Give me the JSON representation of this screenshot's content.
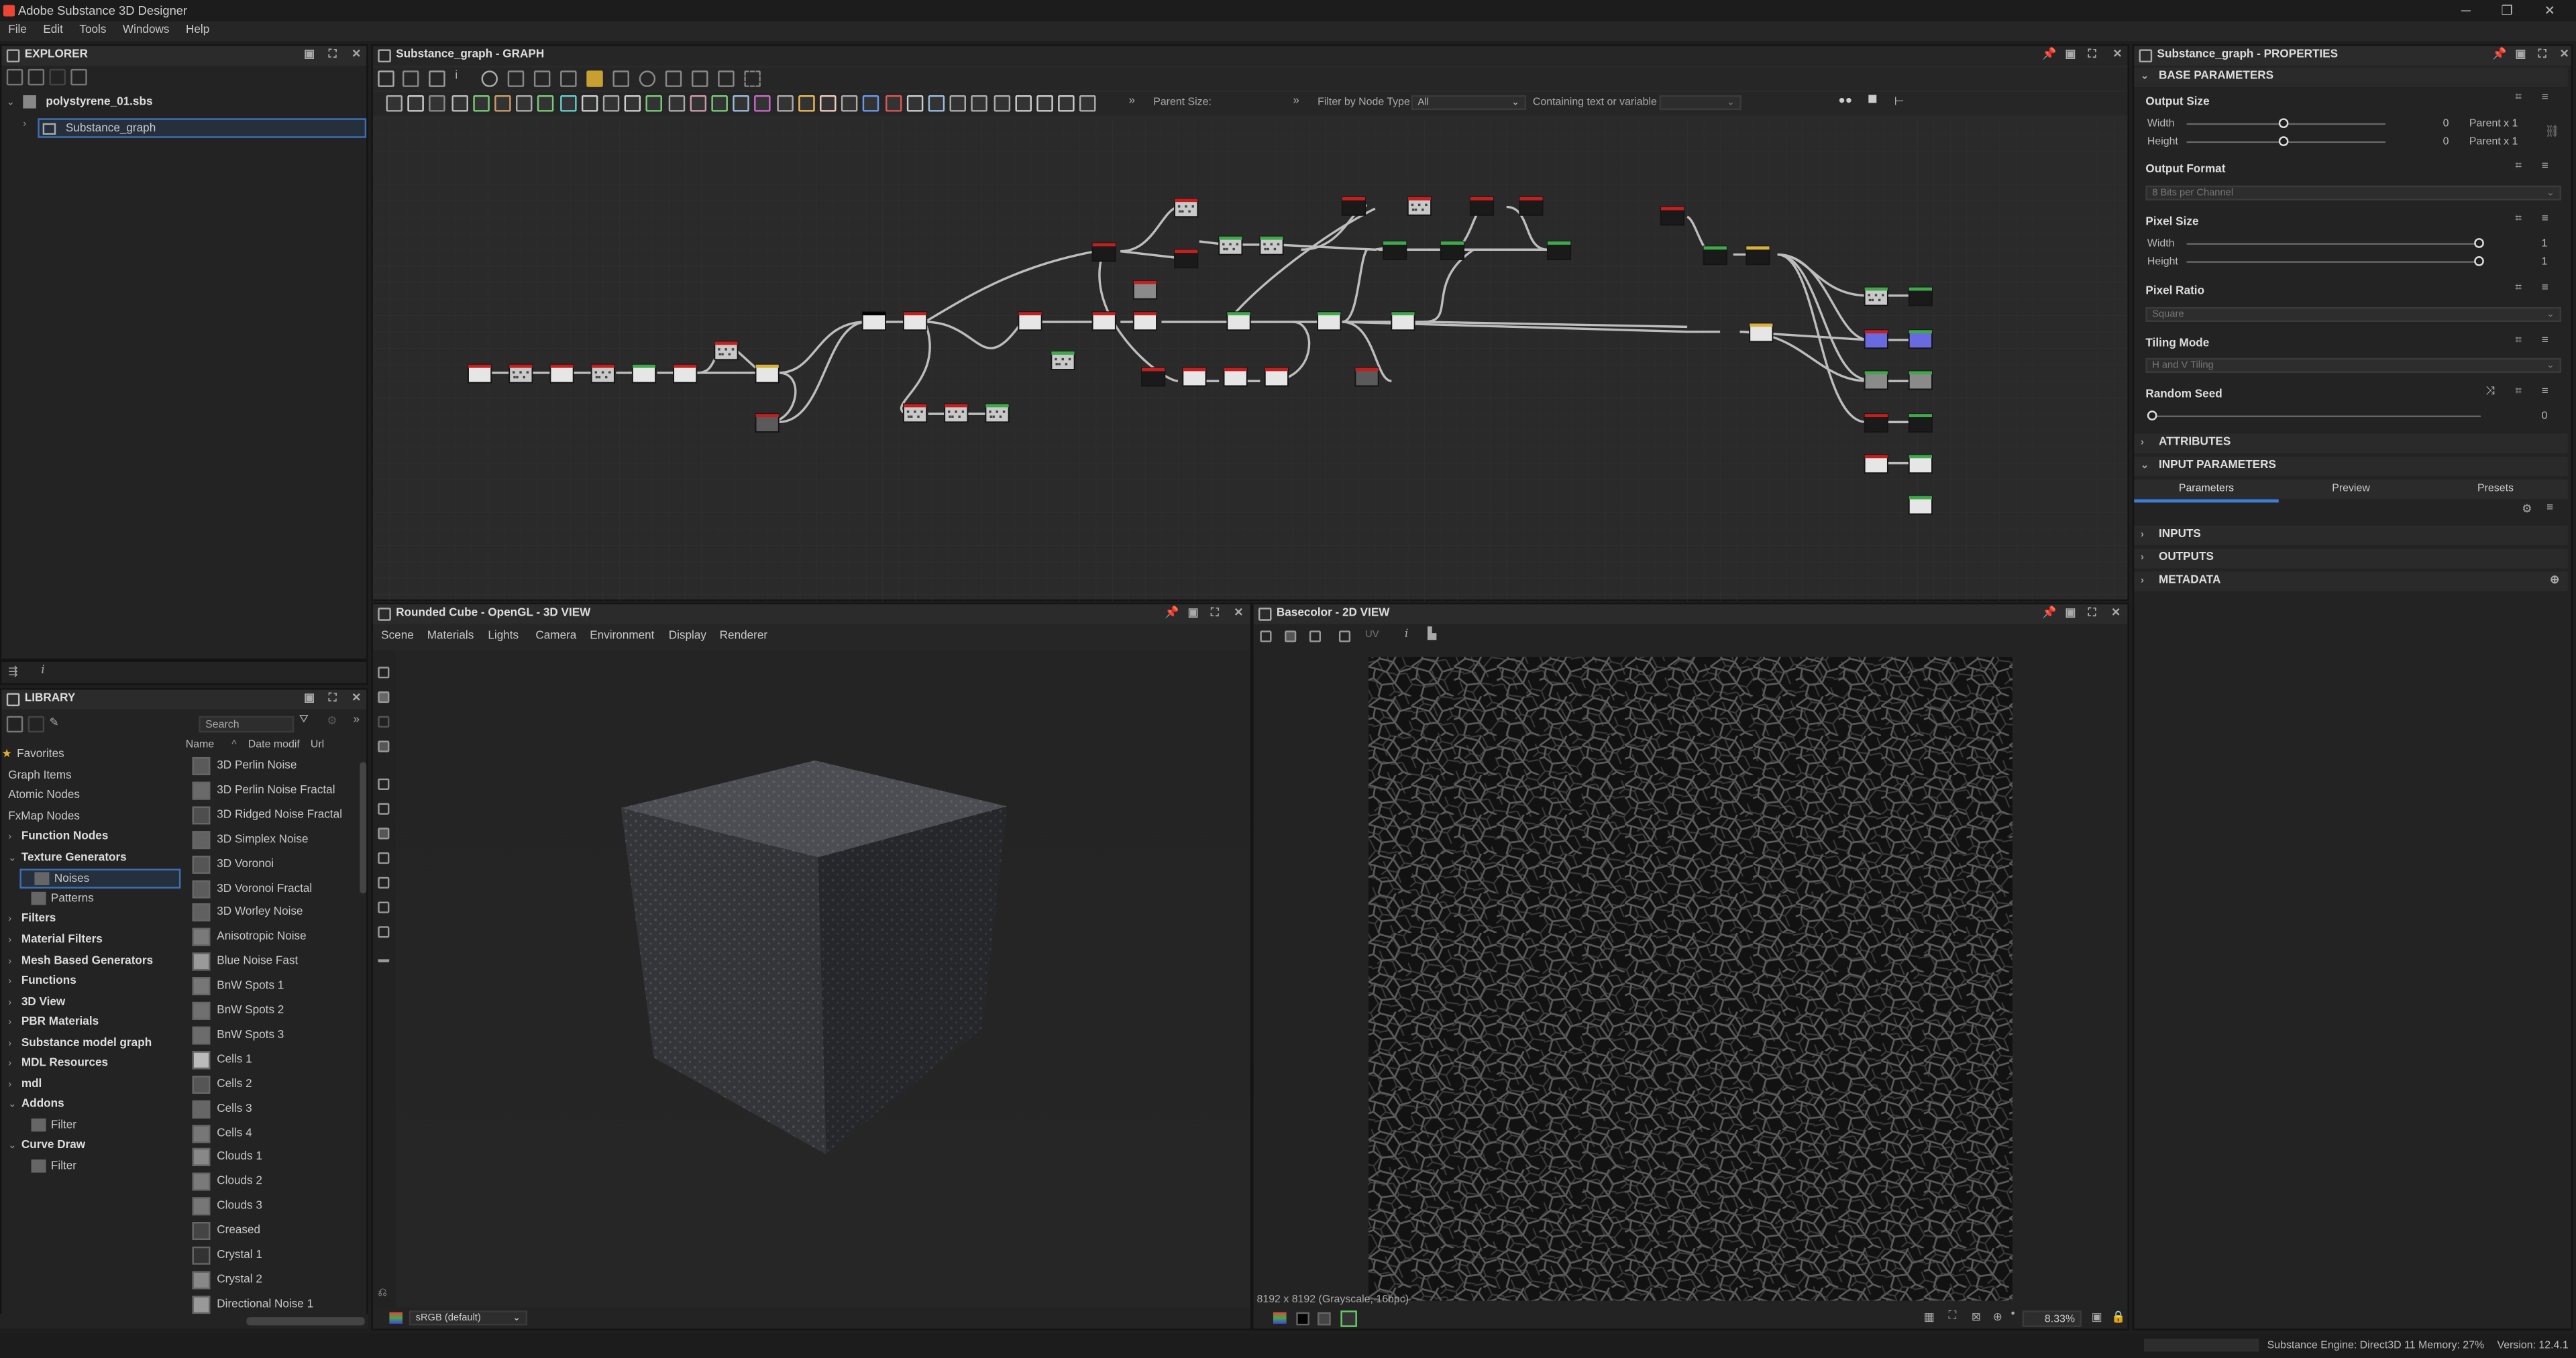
{
  "window": {
    "title": "Adobe Substance 3D Designer",
    "menu": [
      "File",
      "Edit",
      "Tools",
      "Windows",
      "Help"
    ]
  },
  "explorer": {
    "title": "EXPLORER",
    "package": "polystyrene_01.sbs",
    "graph": "Substance_graph"
  },
  "library": {
    "title": "LIBRARY",
    "search_placeholder": "Search",
    "columns": {
      "name": "Name",
      "date": "Date modif",
      "url": "Url"
    },
    "categories": [
      {
        "label": "Favorites",
        "bold": false,
        "indent": 0,
        "caret": "",
        "star": true
      },
      {
        "label": "Graph Items",
        "bold": false,
        "indent": 0,
        "caret": ""
      },
      {
        "label": "Atomic Nodes",
        "bold": false,
        "indent": 0,
        "caret": ""
      },
      {
        "label": "FxMap Nodes",
        "bold": false,
        "indent": 0,
        "caret": ""
      },
      {
        "label": "Function Nodes",
        "bold": true,
        "indent": 0,
        "caret": "›"
      },
      {
        "label": "Texture Generators",
        "bold": true,
        "indent": 0,
        "caret": "⌄"
      },
      {
        "label": "Noises",
        "bold": false,
        "indent": 1,
        "caret": "",
        "selected": true
      },
      {
        "label": "Patterns",
        "bold": false,
        "indent": 1,
        "caret": ""
      },
      {
        "label": "Filters",
        "bold": true,
        "indent": 0,
        "caret": "›"
      },
      {
        "label": "Material Filters",
        "bold": true,
        "indent": 0,
        "caret": "›"
      },
      {
        "label": "Mesh Based Generators",
        "bold": true,
        "indent": 0,
        "caret": "›"
      },
      {
        "label": "Functions",
        "bold": true,
        "indent": 0,
        "caret": "›"
      },
      {
        "label": "3D View",
        "bold": true,
        "indent": 0,
        "caret": "›"
      },
      {
        "label": "PBR Materials",
        "bold": true,
        "indent": 0,
        "caret": "›"
      },
      {
        "label": "Substance model graph",
        "bold": true,
        "indent": 0,
        "caret": "›"
      },
      {
        "label": "MDL Resources",
        "bold": true,
        "indent": 0,
        "caret": "›"
      },
      {
        "label": "mdl",
        "bold": true,
        "indent": 0,
        "caret": "›"
      },
      {
        "label": "Addons",
        "bold": true,
        "indent": 0,
        "caret": "⌄"
      },
      {
        "label": "Filter",
        "bold": false,
        "indent": 1,
        "caret": ""
      },
      {
        "label": "Curve Draw",
        "bold": true,
        "indent": 0,
        "caret": "⌄"
      },
      {
        "label": "Filter",
        "bold": false,
        "indent": 1,
        "caret": ""
      }
    ],
    "items": [
      "3D Perlin Noise",
      "3D Perlin Noise Fractal",
      "3D Ridged Noise Fractal",
      "3D Simplex Noise",
      "3D Voronoi",
      "3D Voronoi Fractal",
      "3D Worley Noise",
      "Anisotropic Noise",
      "Blue Noise Fast",
      "BnW Spots 1",
      "BnW Spots 2",
      "BnW Spots 3",
      "Cells 1",
      "Cells 2",
      "Cells 3",
      "Cells 4",
      "Clouds 1",
      "Clouds 2",
      "Clouds 3",
      "Creased",
      "Crystal 1",
      "Crystal 2",
      "Directional Noise 1"
    ]
  },
  "graph": {
    "title": "Substance_graph - GRAPH",
    "parent_size_label": "Parent Size:",
    "filter_label": "Filter by Node Type",
    "filter_value": "All",
    "containing_label": "Containing text or variable"
  },
  "view3d": {
    "title": "Rounded Cube - OpenGL - 3D VIEW",
    "menu": [
      "Scene",
      "Materials",
      "Lights",
      "Camera",
      "Environment",
      "Display",
      "Renderer"
    ],
    "colorspace": "sRGB (default)"
  },
  "view2d": {
    "title": "Basecolor - 2D VIEW",
    "uv_label": "UV",
    "image_info": "8192 x 8192 (Grayscale, 16bpc)",
    "zoom": "8.33%"
  },
  "properties": {
    "title": "Substance_graph - PROPERTIES",
    "base_section": "BASE PARAMETERS",
    "output_size": {
      "label": "Output Size",
      "width_label": "Width",
      "height_label": "Height",
      "width_value": "0",
      "height_value": "0",
      "width_rel": "Parent x 1",
      "height_rel": "Parent x 1"
    },
    "output_format": {
      "label": "Output Format",
      "value": "8 Bits per Channel"
    },
    "pixel_size": {
      "label": "Pixel Size",
      "width_label": "Width",
      "height_label": "Height",
      "width_value": "1",
      "height_value": "1"
    },
    "pixel_ratio": {
      "label": "Pixel Ratio",
      "value": "Square"
    },
    "tiling_mode": {
      "label": "Tiling Mode",
      "value": "H and V Tiling"
    },
    "random_seed": {
      "label": "Random Seed",
      "value": "0"
    },
    "attributes": "ATTRIBUTES",
    "input_parameters": "INPUT PARAMETERS",
    "tabs": [
      "Parameters",
      "Preview",
      "Presets"
    ],
    "inputs": "INPUTS",
    "outputs": "OUTPUTS",
    "metadata": "METADATA"
  },
  "status": {
    "engine": "Substance Engine: Direct3D 11  Memory: 27%",
    "version": "Version: 12.4.1"
  }
}
